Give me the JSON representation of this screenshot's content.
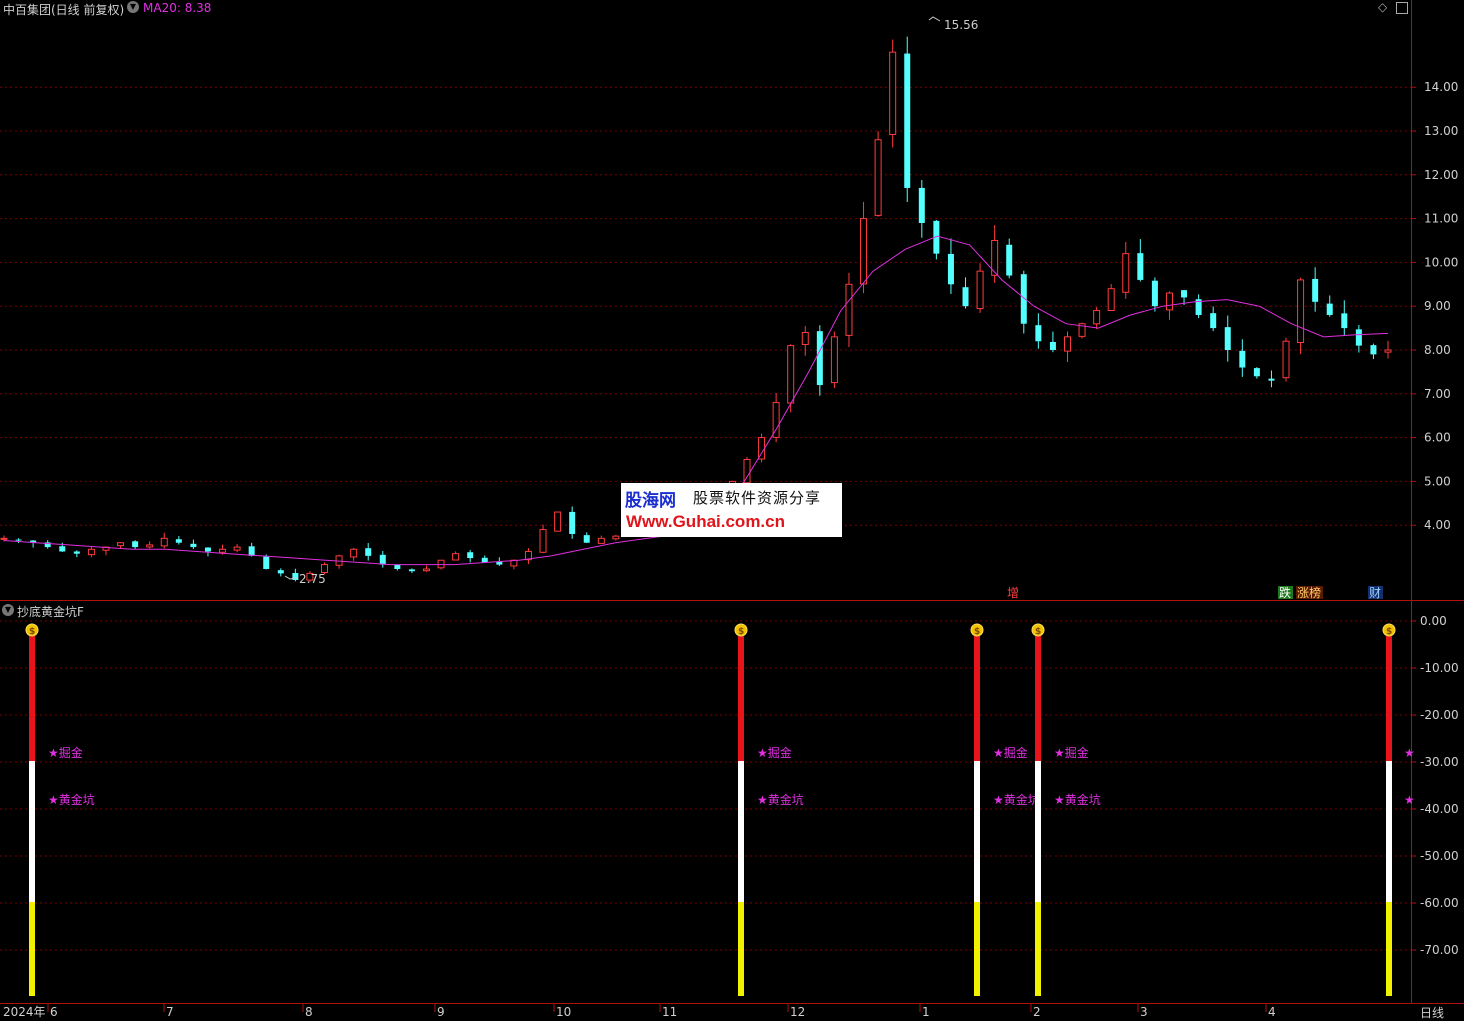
{
  "header": {
    "stock_title": "中百集团(日线 前复权)",
    "ma_label": "MA20: 8.38",
    "indicator_title": "抄底黄金坑F"
  },
  "colors": {
    "background": "#000000",
    "grid": "#8b0000",
    "up": "#ff3b3b",
    "down": "#54ffff",
    "ma": "#e030e0",
    "signal_red": "#e8141b",
    "signal_white": "#ffffff",
    "signal_yellow": "#f2f200"
  },
  "price_axis": {
    "ticks": [
      "14.00",
      "13.00",
      "12.00",
      "11.00",
      "10.00",
      "9.00",
      "8.00",
      "7.00",
      "6.00",
      "5.00",
      "4.00"
    ],
    "high_label": "15.56",
    "low_label": "2.75"
  },
  "indicator_axis": {
    "ticks": [
      "0.00",
      "-10.00",
      "-20.00",
      "-30.00",
      "-40.00",
      "-50.00",
      "-60.00",
      "-70.00"
    ]
  },
  "date_axis": {
    "labels": [
      "2024年",
      "6",
      "7",
      "8",
      "9",
      "10",
      "11",
      "12",
      "1",
      "2",
      "3",
      "4"
    ],
    "period_button": "日线"
  },
  "event_markers": {
    "zeng": "增",
    "die": "跌",
    "zhangting": "涨榜",
    "cai": "财"
  },
  "signals": {
    "label_dig": "★掘金",
    "label_pit": "★黄金坑",
    "coin_icon": "money-bag-icon",
    "columns": [
      {
        "date": "2024-05",
        "value": 0
      },
      {
        "date": "2024-11",
        "value": 0
      },
      {
        "date": "2025-01",
        "value": 0
      },
      {
        "date": "2025-02",
        "value": 0
      },
      {
        "date": "2025-04",
        "value": 0
      }
    ]
  },
  "watermark": {
    "brand": "股海网",
    "slogan": "股票软件资源分享",
    "url": "Www.Guhai.com.cn"
  },
  "chart_data": {
    "type": "candlestick",
    "series_name": "MA20",
    "ohlc_approx_close": [
      3.7,
      3.65,
      3.6,
      3.5,
      3.4,
      3.35,
      3.45,
      3.5,
      3.6,
      3.5,
      3.55,
      3.7,
      3.6,
      3.5,
      3.4,
      3.45,
      3.5,
      3.3,
      3.0,
      2.9,
      2.75,
      2.9,
      3.1,
      3.3,
      3.45,
      3.3,
      3.1,
      3.0,
      2.95,
      3.0,
      3.2,
      3.35,
      3.25,
      3.15,
      3.1,
      3.2,
      3.4,
      3.9,
      4.3,
      3.8,
      3.6,
      3.7,
      3.75,
      3.8,
      3.85,
      3.9,
      3.95,
      4.0,
      4.2,
      4.6,
      5.0,
      5.5,
      6.0,
      6.8,
      8.1,
      8.4,
      7.2,
      8.3,
      9.5,
      11.0,
      12.8,
      14.8,
      11.7,
      10.9,
      10.2,
      9.5,
      9.0,
      9.8,
      10.5,
      9.7,
      8.6,
      8.2,
      8.0,
      8.3,
      8.6,
      8.9,
      9.4,
      10.2,
      9.6,
      9.0,
      9.3,
      9.2,
      8.8,
      8.5,
      8.0,
      7.6,
      7.4,
      7.3,
      8.2,
      9.6,
      9.1,
      8.8,
      8.5,
      8.1,
      7.9,
      8.0
    ],
    "ma20_approx": [
      3.65,
      3.6,
      3.55,
      3.5,
      3.45,
      3.45,
      3.4,
      3.35,
      3.3,
      3.25,
      3.2,
      3.15,
      3.1,
      3.1,
      3.1,
      3.15,
      3.2,
      3.3,
      3.45,
      3.6,
      3.7,
      3.8,
      4.2,
      5.0,
      6.2,
      7.5,
      8.9,
      9.8,
      10.3,
      10.6,
      10.4,
      9.6,
      9.0,
      8.6,
      8.5,
      8.8,
      9.0,
      9.1,
      9.15,
      9.0,
      8.6,
      8.3,
      8.35,
      8.38
    ],
    "ylim": [
      2.5,
      15.7
    ],
    "indicator": {
      "name": "抄底黄金坑F",
      "ylim": [
        -80,
        2
      ],
      "bands": [
        {
          "from": 0,
          "to": -30,
          "color": "red"
        },
        {
          "from": -30,
          "to": -60,
          "color": "white"
        },
        {
          "from": -60,
          "to": -80,
          "color": "yellow"
        }
      ]
    }
  }
}
